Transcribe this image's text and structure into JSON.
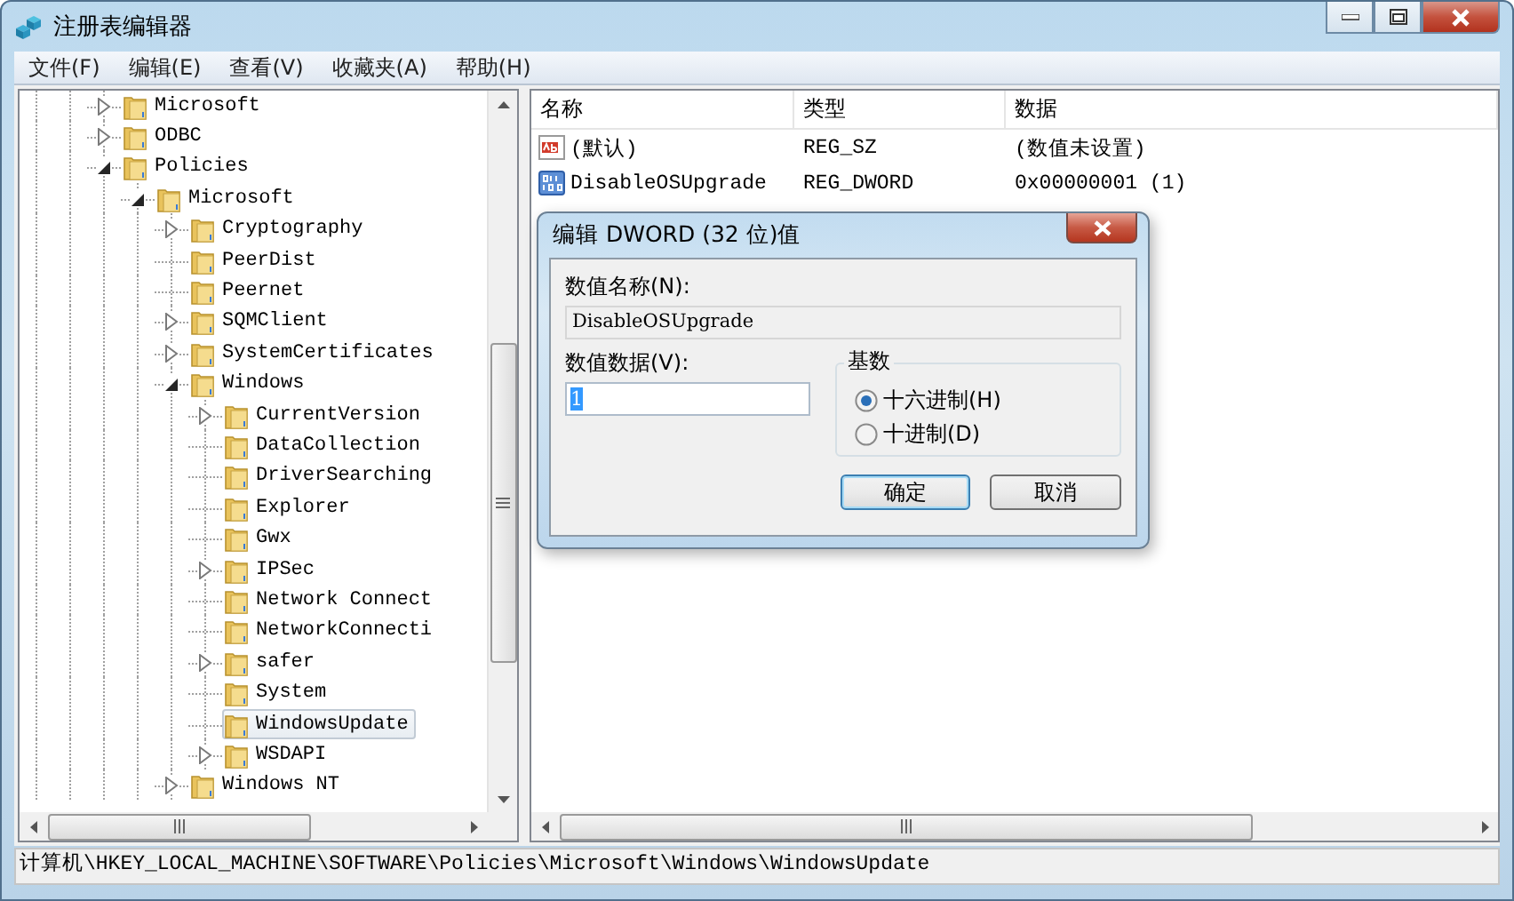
{
  "window": {
    "title": "注册表编辑器"
  },
  "menu": [
    "文件(F)",
    "编辑(E)",
    "查看(V)",
    "收藏夹(A)",
    "帮助(H)"
  ],
  "tree": {
    "items": [
      {
        "label": "Microsoft",
        "expanded": false,
        "selected": false
      },
      {
        "label": "ODBC",
        "expanded": false,
        "selected": false
      },
      {
        "label": "Policies",
        "expanded": true,
        "selected": false,
        "children": [
          {
            "label": "Microsoft",
            "expanded": true,
            "selected": false,
            "children": [
              {
                "label": "Cryptography",
                "expanded": false,
                "selected": false
              },
              {
                "label": "PeerDist",
                "selected": false
              },
              {
                "label": "Peernet",
                "selected": false
              },
              {
                "label": "SQMClient",
                "expanded": false,
                "selected": false
              },
              {
                "label": "SystemCertificates",
                "expanded": false,
                "selected": false
              },
              {
                "label": "Windows",
                "expanded": true,
                "selected": false,
                "children": [
                  {
                    "label": "CurrentVersion",
                    "expanded": false,
                    "selected": false
                  },
                  {
                    "label": "DataCollection",
                    "selected": false
                  },
                  {
                    "label": "DriverSearching",
                    "selected": false
                  },
                  {
                    "label": "Explorer",
                    "selected": false
                  },
                  {
                    "label": "Gwx",
                    "selected": false
                  },
                  {
                    "label": "IPSec",
                    "expanded": false,
                    "selected": false
                  },
                  {
                    "label": "Network Connect",
                    "selected": false
                  },
                  {
                    "label": "NetworkConnecti",
                    "selected": false
                  },
                  {
                    "label": "safer",
                    "expanded": false,
                    "selected": false
                  },
                  {
                    "label": "System",
                    "selected": false
                  },
                  {
                    "label": "WindowsUpdate",
                    "selected": true
                  },
                  {
                    "label": "WSDAPI",
                    "expanded": false,
                    "selected": false
                  }
                ]
              },
              {
                "label": "Windows NT",
                "expanded": false,
                "selected": false
              }
            ]
          }
        ]
      }
    ]
  },
  "list": {
    "columns": [
      "名称",
      "类型",
      "数据"
    ],
    "rows": [
      {
        "kind": "string",
        "name": "(默认)",
        "type": "REG_SZ",
        "data": "(数值未设置)"
      },
      {
        "kind": "dword",
        "name": "DisableOSUpgrade",
        "type": "REG_DWORD",
        "data": "0x00000001 (1)"
      }
    ]
  },
  "dialog": {
    "title": "编辑 DWORD (32 位)值",
    "name_label": "数值名称(N):",
    "name_value": "DisableOSUpgrade",
    "data_label": "数值数据(V):",
    "data_value": "1",
    "base_label": "基数",
    "bases": [
      {
        "label": "十六进制(H)",
        "selected": true
      },
      {
        "label": "十进制(D)",
        "selected": false
      }
    ],
    "buttons": [
      {
        "label": "确定",
        "default": true
      },
      {
        "label": "取消",
        "default": false
      }
    ]
  },
  "status_bar": "计算机\\HKEY_LOCAL_MACHINE\\SOFTWARE\\Policies\\Microsoft\\Windows\\WindowsUpdate"
}
